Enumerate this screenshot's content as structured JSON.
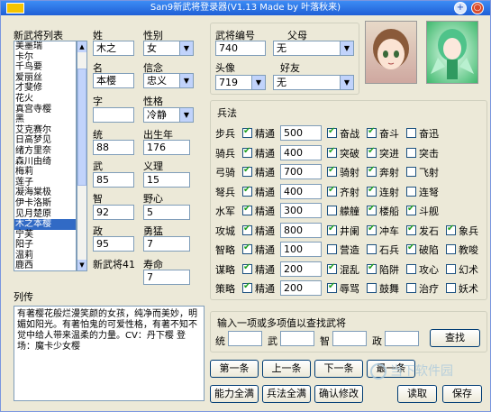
{
  "window": {
    "title": "San9新武将登录器(V1.13 Made by 叶落秋来)"
  },
  "list": {
    "label": "新武将列表",
    "items": [
      "美墨瑞",
      "卡尔",
      "千鸟要",
      "爱丽丝",
      "才斐修",
      "花火",
      "真宫寺樱",
      "黑",
      "艾克赛尔",
      "日高梦见",
      "绪方里奈",
      "森川由绮",
      "梅莉",
      "莲子",
      "凝海棠极",
      "伊卡洛斯",
      "见月楚原",
      "木之本樱",
      "宁芙",
      "阳子",
      "温莉",
      "鹿西"
    ],
    "selected_index": 17
  },
  "basic": {
    "surname_label": "姓",
    "surname": "木之",
    "gender_label": "性别",
    "gender": "女",
    "name_label": "名",
    "name": "本樱",
    "belief_label": "信念",
    "belief": "忠义",
    "zi_label": "字",
    "zi": "",
    "personality_label": "性格",
    "personality": "冷静",
    "tong_label": "统",
    "tong": "88",
    "birth_label": "出生年",
    "birth": "176",
    "wu_label": "武",
    "wu": "85",
    "yili_label": "义理",
    "yili": "15",
    "zhi_label": "智",
    "zhi": "92",
    "yexin_label": "野心",
    "yexin": "5",
    "zheng_label": "政",
    "zheng": "95",
    "yongmeng_label": "勇猛",
    "yongmeng": "7",
    "new_general_label": "新武将41",
    "shouming_label": "寿命",
    "shouming": "7"
  },
  "ids": {
    "general_no_label": "武将编号",
    "general_no": "740",
    "parent_label": "父母",
    "parent": "无",
    "portrait_label": "头像",
    "portrait": "719",
    "friend_label": "好友",
    "friend": "无"
  },
  "bingfa": {
    "title": "兵法",
    "rows": [
      {
        "name": "步兵",
        "level": "精通",
        "value": "500",
        "s": [
          {
            "t": "奋战",
            "on": true
          },
          {
            "t": "奋斗",
            "on": true
          },
          {
            "t": "奋迅",
            "on": false
          }
        ]
      },
      {
        "name": "骑兵",
        "level": "精通",
        "value": "400",
        "s": [
          {
            "t": "突破",
            "on": true
          },
          {
            "t": "突进",
            "on": true
          },
          {
            "t": "突击",
            "on": false
          }
        ]
      },
      {
        "name": "弓骑",
        "level": "精通",
        "value": "700",
        "s": [
          {
            "t": "骑射",
            "on": true
          },
          {
            "t": "奔射",
            "on": true
          },
          {
            "t": "飞射",
            "on": false
          }
        ]
      },
      {
        "name": "弩兵",
        "level": "精通",
        "value": "400",
        "s": [
          {
            "t": "齐射",
            "on": true
          },
          {
            "t": "连射",
            "on": true
          },
          {
            "t": "连弩",
            "on": false
          }
        ]
      },
      {
        "name": "水军",
        "level": "精通",
        "value": "300",
        "s": [
          {
            "t": "艨艟",
            "on": false
          },
          {
            "t": "楼船",
            "on": true
          },
          {
            "t": "斗舰",
            "on": true
          }
        ]
      },
      {
        "name": "攻城",
        "level": "精通",
        "value": "800",
        "s": [
          {
            "t": "井阑",
            "on": true
          },
          {
            "t": "冲车",
            "on": true
          },
          {
            "t": "发石",
            "on": true
          },
          {
            "t": "象兵",
            "on": true
          }
        ]
      },
      {
        "name": "智略",
        "level": "精通",
        "value": "100",
        "s": [
          {
            "t": "营造",
            "on": false
          },
          {
            "t": "石兵",
            "on": false
          },
          {
            "t": "破陷",
            "on": true
          },
          {
            "t": "教唆",
            "on": false
          }
        ]
      },
      {
        "name": "谋略",
        "level": "精通",
        "value": "200",
        "s": [
          {
            "t": "混乱",
            "on": true
          },
          {
            "t": "陷阱",
            "on": true
          },
          {
            "t": "攻心",
            "on": false
          },
          {
            "t": "幻术",
            "on": false
          }
        ]
      },
      {
        "name": "策略",
        "level": "精通",
        "value": "200",
        "s": [
          {
            "t": "辱骂",
            "on": true
          },
          {
            "t": "鼓舞",
            "on": false
          },
          {
            "t": "治疗",
            "on": false
          },
          {
            "t": "妖术",
            "on": false
          }
        ]
      }
    ]
  },
  "search": {
    "title": "输入一项或多项值以查找武将",
    "tong": "统",
    "wu": "武",
    "zhi": "智",
    "zheng": "政",
    "button": "查找"
  },
  "liezhuan": {
    "label": "列传",
    "text": "有著樱花般烂漫笑颜的女孩，纯净而美妙，明媚如阳光。有著怕鬼的可爱性格，有著不知不觉中给人带来温柔的力量。CV：丹下樱 登场：魔卡少女樱"
  },
  "buttons": {
    "first": "第一条",
    "prev": "上一条",
    "next": "下一条",
    "last": "最一条",
    "max_ability": "能力全满",
    "max_bingfa": "兵法全满",
    "confirm": "确认修改",
    "load": "读取",
    "save": "保存"
  },
  "watermark": "当下软件园"
}
